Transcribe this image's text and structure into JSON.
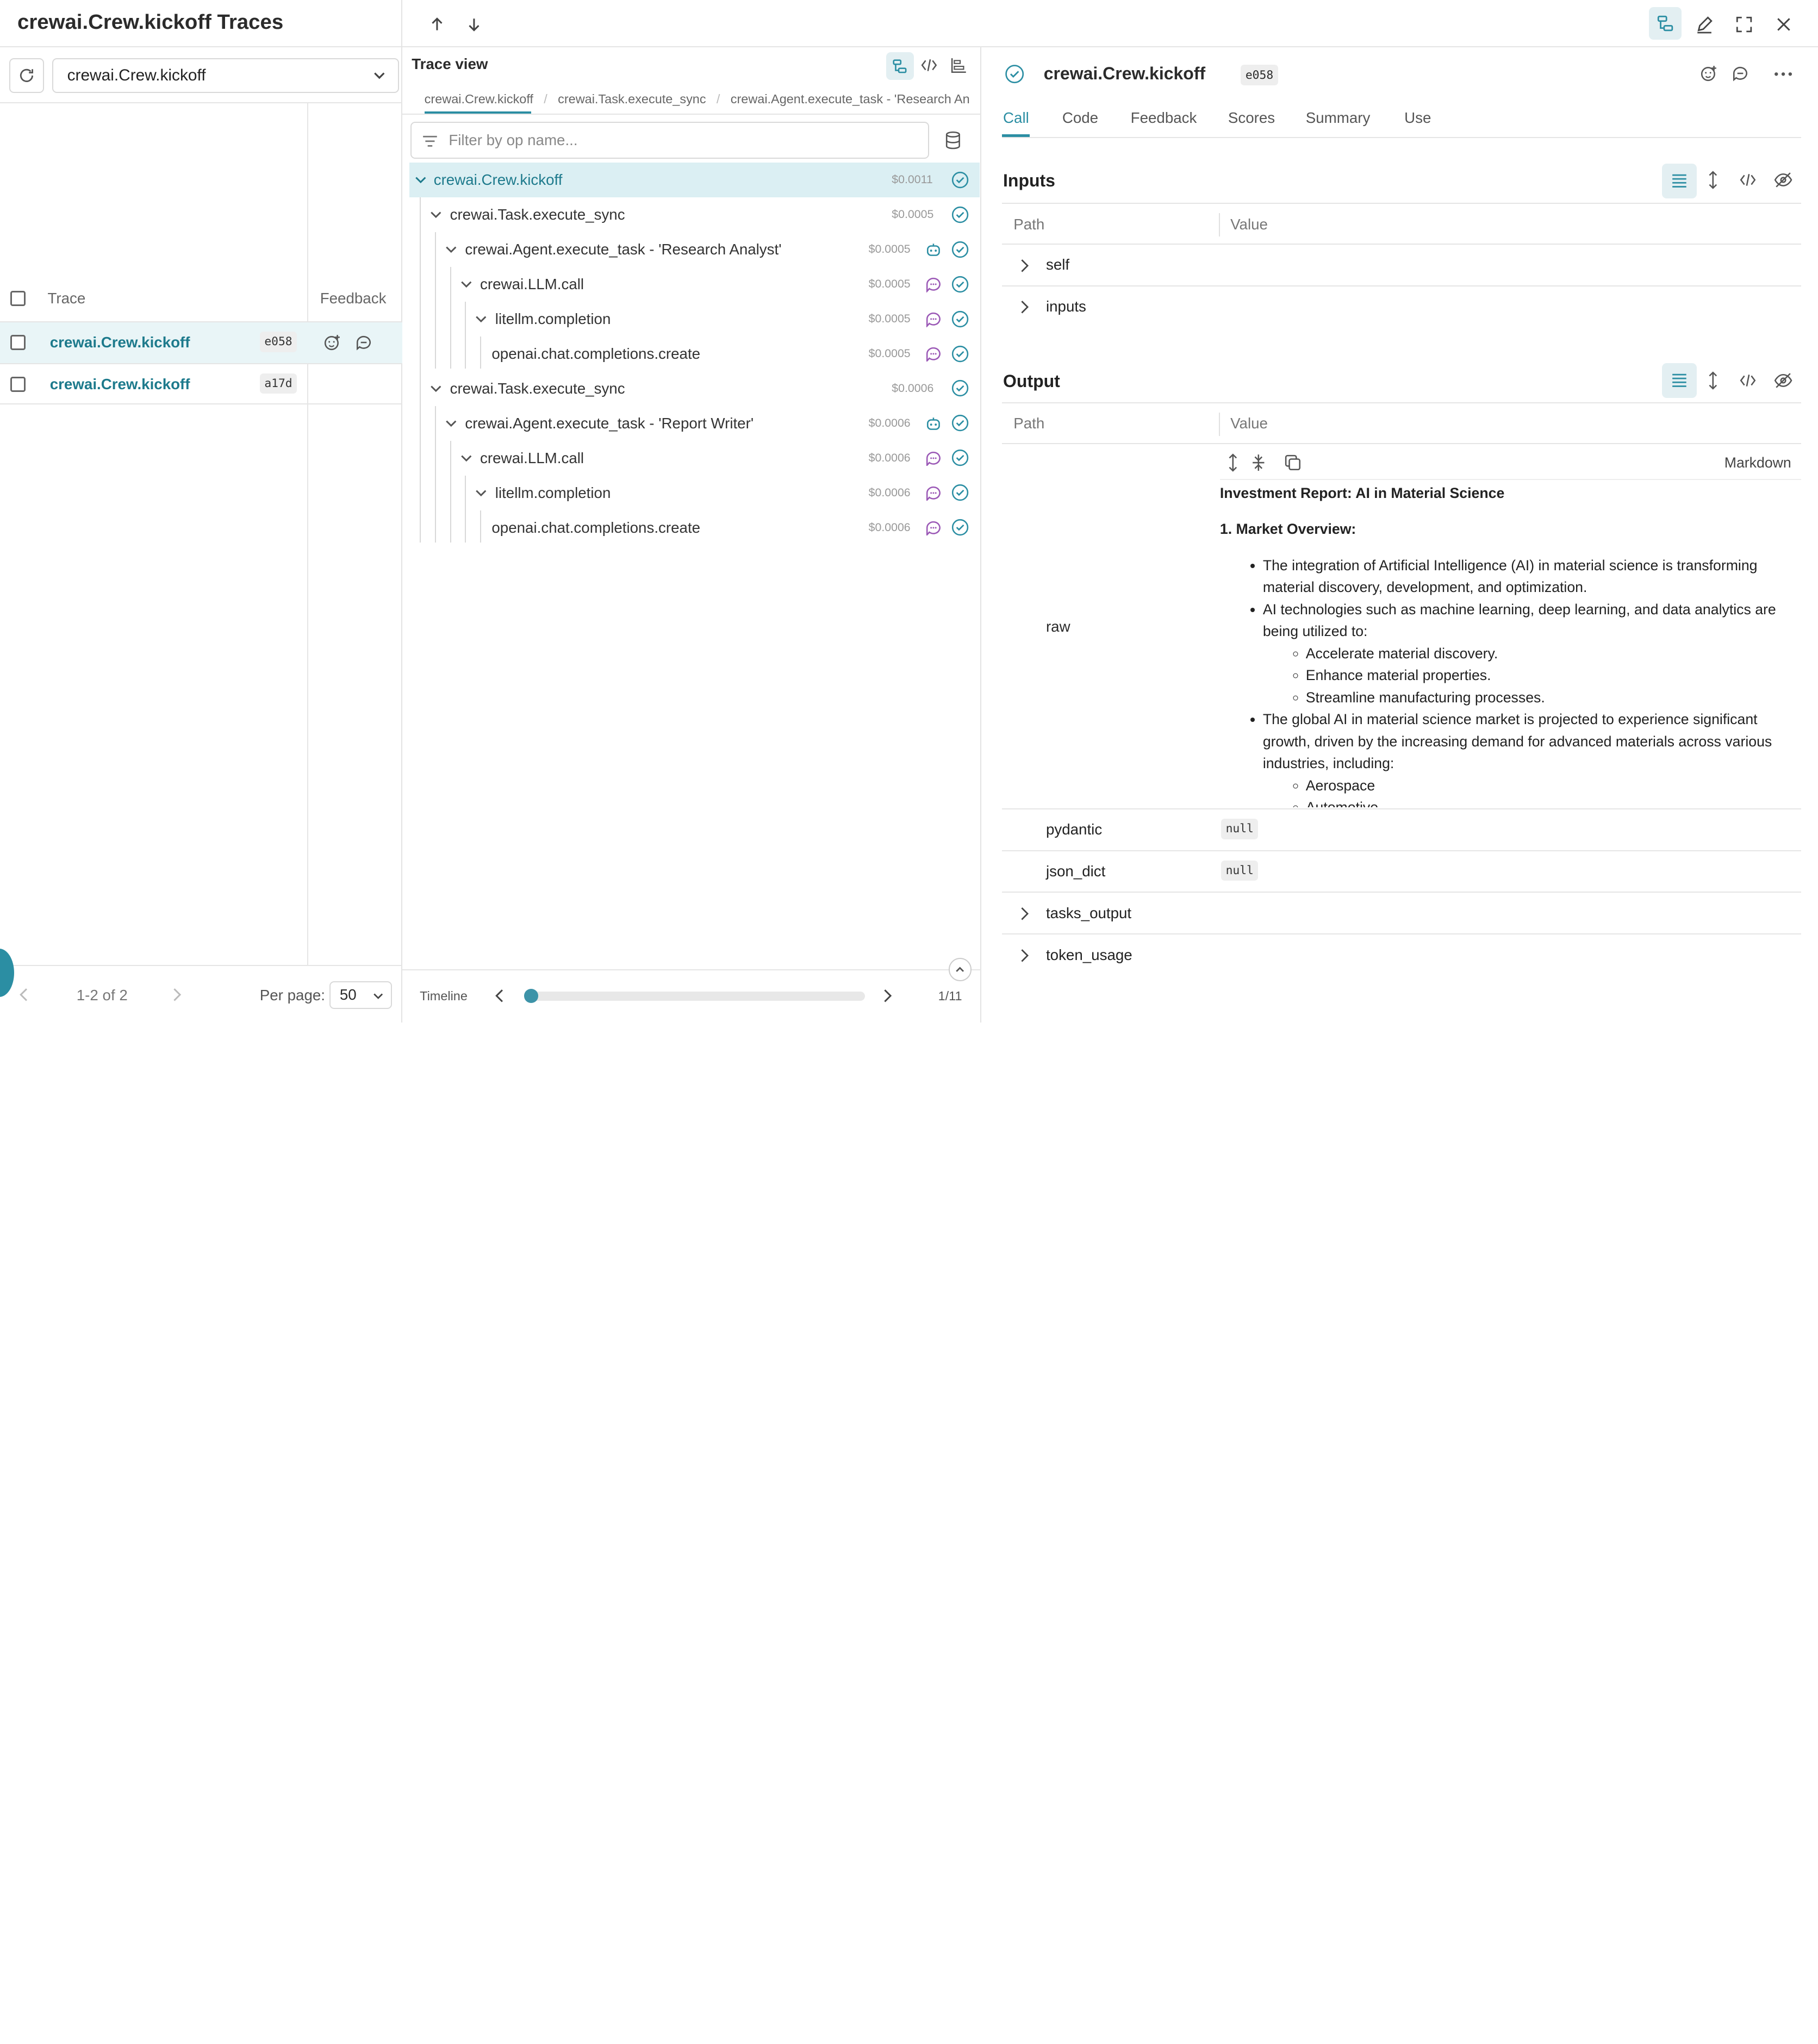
{
  "header": {
    "title": "crewai.Crew.kickoff Traces"
  },
  "left": {
    "filter_value": "crewai.Crew.kickoff",
    "columns": {
      "trace": "Trace",
      "feedback": "Feedback"
    },
    "rows": [
      {
        "name": "crewai.Crew.kickoff",
        "id": "e058"
      },
      {
        "name": "crewai.Crew.kickoff",
        "id": "a17d"
      }
    ],
    "pagination": {
      "info": "1-2 of 2",
      "per_page_label": "Per page:",
      "per_page_value": "50"
    }
  },
  "trace_view": {
    "title": "Trace view",
    "breadcrumbs": [
      "crewai.Crew.kickoff",
      "/",
      "crewai.Task.execute_sync",
      "/",
      "crewai.Agent.execute_task - 'Research Analyst'",
      "/"
    ],
    "search_placeholder": "Filter by op name...",
    "nodes": [
      {
        "label": "crewai.Crew.kickoff",
        "cost": "$0.0011"
      },
      {
        "label": "crewai.Task.execute_sync",
        "cost": "$0.0005"
      },
      {
        "label": "crewai.Agent.execute_task - 'Research Analyst'",
        "cost": "$0.0005"
      },
      {
        "label": "crewai.LLM.call",
        "cost": "$0.0005"
      },
      {
        "label": "litellm.completion",
        "cost": "$0.0005"
      },
      {
        "label": "openai.chat.completions.create",
        "cost": "$0.0005"
      },
      {
        "label": "crewai.Task.execute_sync",
        "cost": "$0.0006"
      },
      {
        "label": "crewai.Agent.execute_task - 'Report Writer'",
        "cost": "$0.0006"
      },
      {
        "label": "crewai.LLM.call",
        "cost": "$0.0006"
      },
      {
        "label": "litellm.completion",
        "cost": "$0.0006"
      },
      {
        "label": "openai.chat.completions.create",
        "cost": "$0.0006"
      }
    ],
    "timeline": {
      "label": "Timeline",
      "count": "1/11",
      "position": 0
    }
  },
  "detail": {
    "title": "crewai.Crew.kickoff",
    "id": "e058",
    "tabs": [
      "Call",
      "Code",
      "Feedback",
      "Scores",
      "Summary",
      "Use"
    ],
    "active_tab": "Call",
    "inputs": {
      "title": "Inputs",
      "path_col": "Path",
      "value_col": "Value",
      "rows": [
        "self",
        "inputs"
      ]
    },
    "output": {
      "title": "Output",
      "path_col": "Path",
      "value_col": "Value",
      "raw_key": "raw",
      "markdown_label": "Markdown",
      "markdown": {
        "heading": "Investment Report: AI in Material Science",
        "section": "1. Market Overview:",
        "b1": "The integration of Artificial Intelligence (AI) in material science is transforming material discovery, development, and optimization.",
        "b2": "AI technologies such as machine learning, deep learning, and data analytics are being utilized to:",
        "b2a": "Accelerate material discovery.",
        "b2b": "Enhance material properties.",
        "b2c": "Streamline manufacturing processes.",
        "b3": "The global AI in material science market is projected to experience significant growth, driven by the increasing demand for advanced materials across various industries, including:",
        "b3a": "Aerospace",
        "b3b": "Automotive"
      },
      "rows": [
        {
          "key": "pydantic",
          "value": "null"
        },
        {
          "key": "json_dict",
          "value": "null"
        },
        {
          "key": "tasks_output"
        },
        {
          "key": "token_usage"
        }
      ]
    }
  },
  "colors": {
    "accent": "#2b8ea3",
    "selected_row": "#e9f5f7"
  }
}
